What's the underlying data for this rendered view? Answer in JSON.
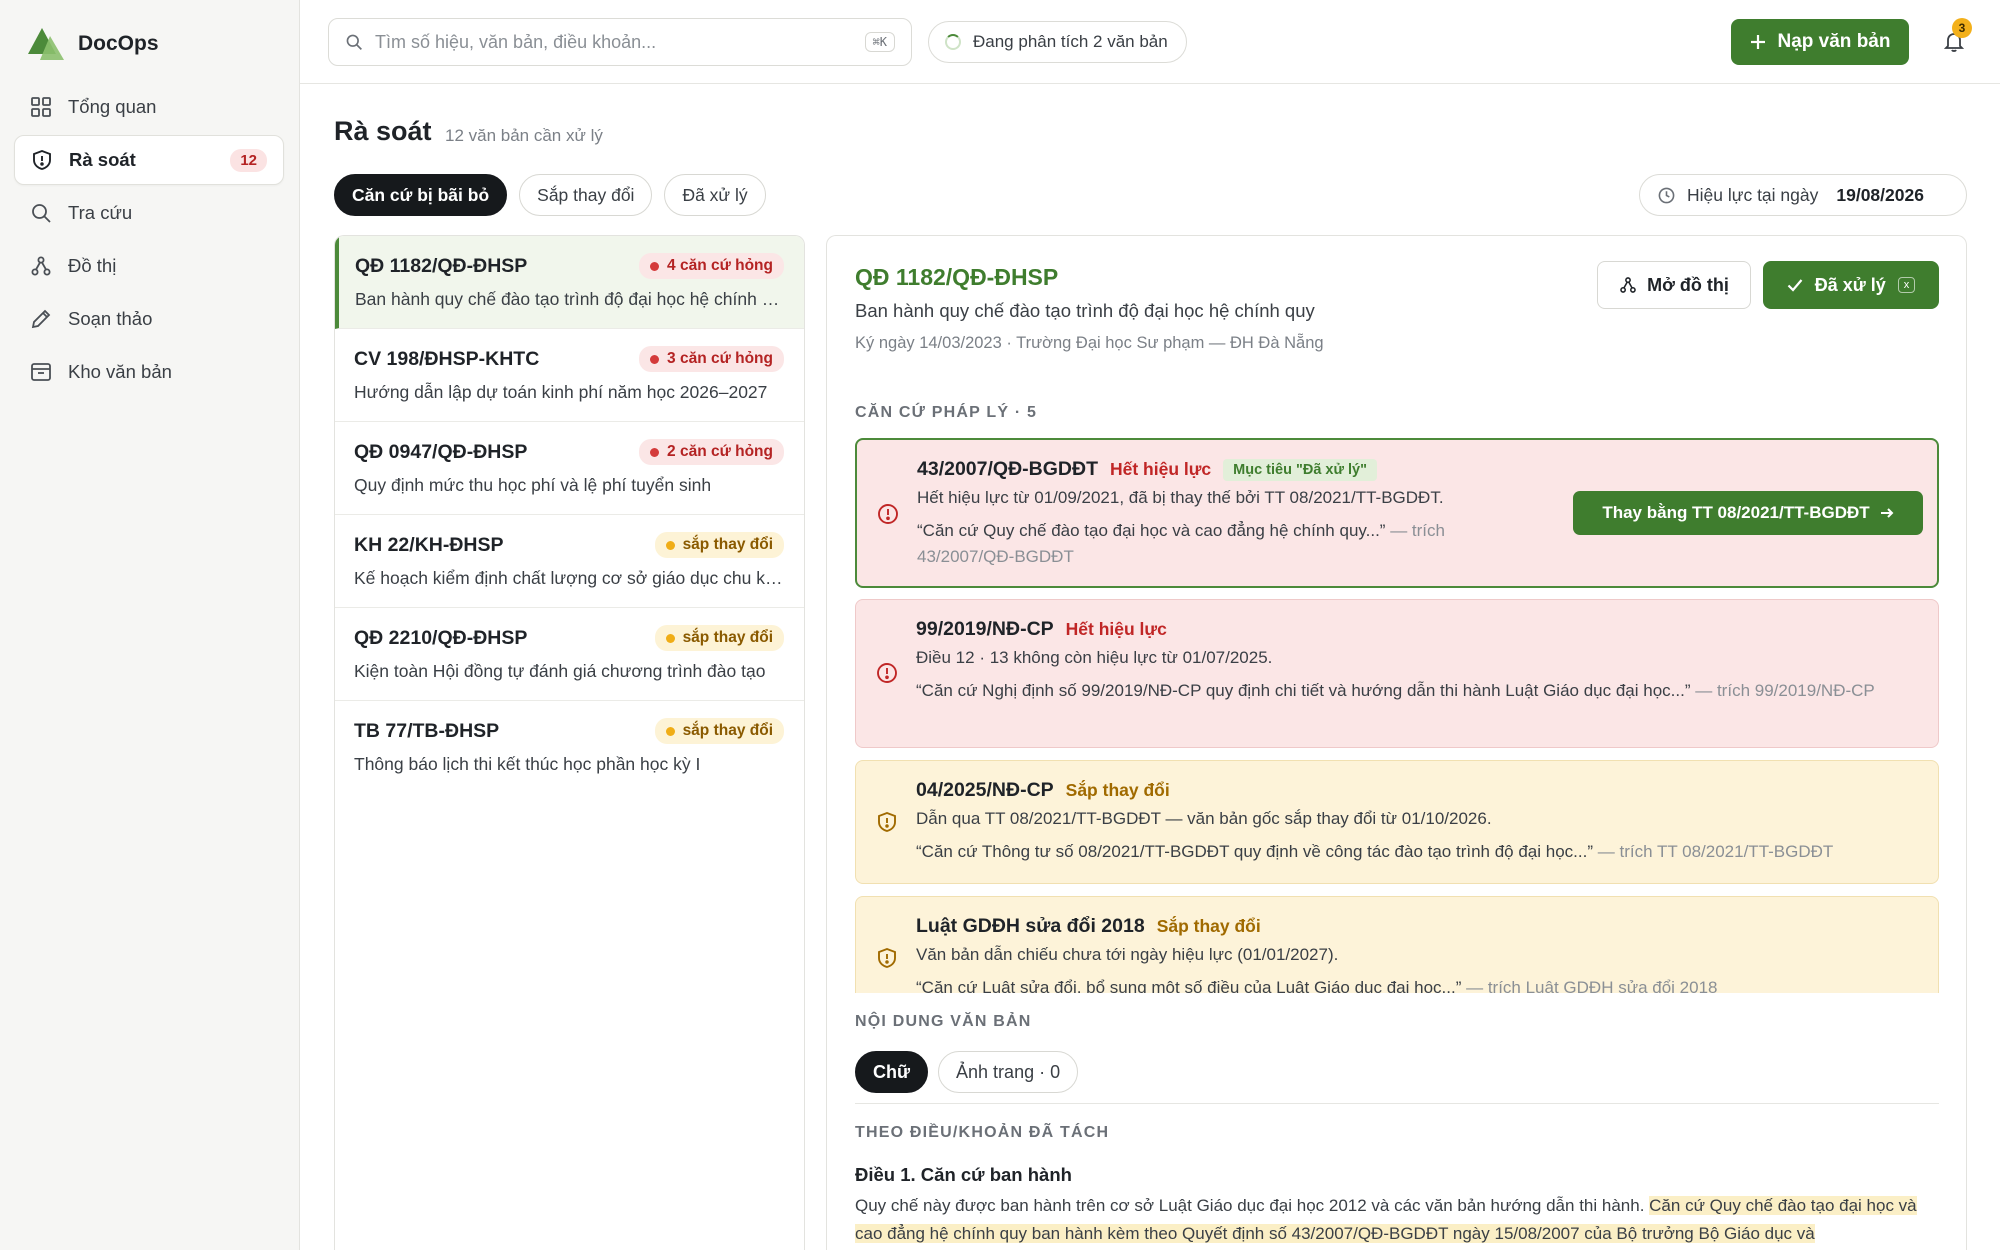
{
  "app": {
    "name": "DocOps"
  },
  "colors": {
    "brand": "#3f7d2e",
    "danger": "#c02626",
    "warning": "#f0ad16"
  },
  "sidebar": {
    "items": [
      {
        "label": "Tổng quan",
        "icon": "grid-icon"
      },
      {
        "label": "Rà soát",
        "icon": "shield-icon",
        "badge": "12",
        "active": true
      },
      {
        "label": "Tra cứu",
        "icon": "search-icon"
      },
      {
        "label": "Đồ thị",
        "icon": "graph-icon"
      },
      {
        "label": "Soạn thảo",
        "icon": "pencil-icon"
      },
      {
        "label": "Kho văn bản",
        "icon": "archive-icon"
      }
    ]
  },
  "topbar": {
    "search_placeholder": "Tìm số hiệu, văn bản, điều khoản...",
    "search_shortcut": "⌘K",
    "status": "Đang phân tích 2 văn bản",
    "upload_label": "Nạp văn bản",
    "notification_count": "3"
  },
  "page": {
    "title": "Rà soát",
    "subtitle": "12 văn bản cần xử lý",
    "filters": [
      "Căn cứ bị bãi bỏ",
      "Sắp thay đổi",
      "Đã xử lý"
    ],
    "effective_label": "Hiệu lực tại ngày",
    "effective_date": "19/08/2026"
  },
  "list": [
    {
      "code": "QĐ 1182/QĐ-ĐHSP",
      "badge": "4 căn cứ hỏng",
      "type": "red",
      "desc": "Ban hành quy chế đào tạo trình độ đại học hệ chính quy"
    },
    {
      "code": "CV 198/ĐHSP-KHTC",
      "badge": "3 căn cứ hỏng",
      "type": "red",
      "desc": "Hướng dẫn lập dự toán kinh phí năm học 2026–2027"
    },
    {
      "code": "QĐ 0947/QĐ-ĐHSP",
      "badge": "2 căn cứ hỏng",
      "type": "red",
      "desc": "Quy định mức thu học phí và lệ phí tuyển sinh"
    },
    {
      "code": "KH 22/KH-ĐHSP",
      "badge": "sắp thay đổi",
      "type": "amber",
      "desc": "Kế hoạch kiểm định chất lượng cơ sở giáo dục chu kỳ II"
    },
    {
      "code": "QĐ 2210/QĐ-ĐHSP",
      "badge": "sắp thay đổi",
      "type": "amber",
      "desc": "Kiện toàn Hội đồng tự đánh giá chương trình đào tạo"
    },
    {
      "code": "TB 77/TB-ĐHSP",
      "badge": "sắp thay đổi",
      "type": "amber",
      "desc": "Thông báo lịch thi kết thúc học phần học kỳ I"
    }
  ],
  "detail": {
    "code": "QĐ 1182/QĐ-ĐHSP",
    "title": "Ban hành quy chế đào tạo trình độ đại học hệ chính quy",
    "meta": "Ký ngày 14/03/2023 · Trường Đại học Sư phạm — ĐH Đà Nẵng",
    "graph_button": "Mở đồ thị",
    "done_button": "Đã xử lý",
    "done_shortcut": "x",
    "basis_label": "CĂN CỨ PHÁP LÝ · 5",
    "basis": [
      {
        "code": "43/2007/QĐ-BGDĐT",
        "status": "Hết hiệu lực",
        "target": "Mục tiêu \"Đã xử lý\"",
        "line": "Hết hiệu lực từ 01/09/2021, đã bị thay thế bởi TT 08/2021/TT-BGDĐT.",
        "quote": "“Căn cứ Quy chế đào tạo đại học và cao đẳng hệ chính quy...”",
        "src": "— trích 43/2007/QĐ-BGDĐT",
        "action": "Thay bằng TT 08/2021/TT-BGDĐT"
      },
      {
        "code": "99/2019/NĐ-CP",
        "status": "Hết hiệu lực",
        "line": "Điều 12 · 13 không còn hiệu lực từ 01/07/2025.",
        "quote": "“Căn cứ Nghị định số 99/2019/NĐ-CP quy định chi tiết và hướng dẫn thi hành Luật Giáo dục đại học...”",
        "src": "— trích 99/2019/NĐ-CP"
      },
      {
        "code": "04/2025/NĐ-CP",
        "status": "Sắp thay đổi",
        "line": "Dẫn qua TT 08/2021/TT-BGDĐT — văn bản gốc sắp thay đổi từ 01/10/2026.",
        "quote": "“Căn cứ Thông tư số 08/2021/TT-BGDĐT quy định về công tác đào tạo trình độ đại học...”",
        "src": "— trích TT 08/2021/TT-BGDĐT"
      },
      {
        "code": "Luật GDĐH sửa đổi 2018",
        "status": "Sắp thay đổi",
        "line": "Văn bản dẫn chiếu chưa tới ngày hiệu lực (01/01/2027).",
        "quote": "“Căn cứ Luật sửa đổi, bổ sung một số điều của Luật Giáo dục đại học...”",
        "src": "— trích Luật GDĐH sửa đổi 2018"
      }
    ],
    "content_label": "NỘI DUNG VĂN BẢN",
    "content_tabs": [
      "Chữ",
      "Ảnh trang · 0"
    ],
    "articles_label": "THEO ĐIỀU/KHOẢN ĐÃ TÁCH",
    "article_title": "Điều 1. Căn cứ ban hành",
    "article_text": "Quy chế này được ban hành trên cơ sở Luật Giáo dục đại học 2012 và các văn bản hướng dẫn thi hành.",
    "article_highlight": "Căn cứ Quy chế đào tạo đại học và cao đẳng hệ chính quy ban hành kèm theo Quyết định số 43/2007/QĐ-BGDĐT ngày 15/08/2007 của Bộ trưởng Bộ Giáo dục và"
  }
}
